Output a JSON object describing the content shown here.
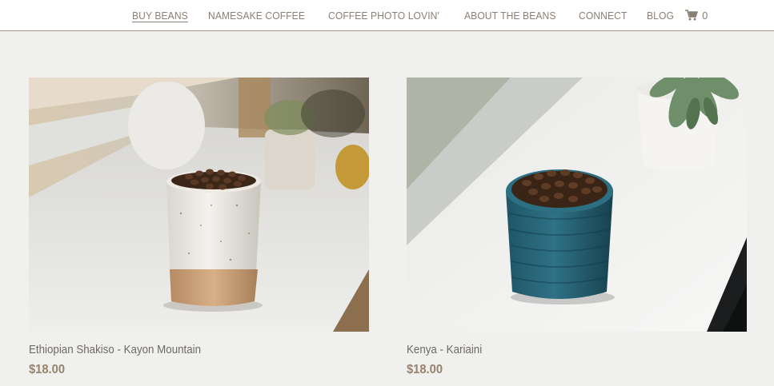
{
  "nav": {
    "items": [
      {
        "label": "BUY BEANS",
        "active": true
      },
      {
        "label": "NAMESAKE COFFEE",
        "active": false
      },
      {
        "label": "COFFEE PHOTO LOVIN'",
        "active": false
      },
      {
        "label": "ABOUT THE BEANS",
        "active": false
      },
      {
        "label": "CONNECT",
        "active": false
      },
      {
        "label": "BLOG",
        "active": false
      }
    ],
    "cart_icon": "shopping-cart-icon",
    "cart_count": "0"
  },
  "products": [
    {
      "name": "Ethiopian Shakiso - Kayon Mountain",
      "price": "$18.00",
      "image": "speckled-cream-cup-of-coffee-beans-photo"
    },
    {
      "name": "Kenya - Kariaini",
      "price": "$18.00",
      "image": "teal-ribbed-cup-of-coffee-beans-photo"
    }
  ],
  "colors": {
    "background": "#f0f0ee",
    "nav_text": "#8a7f74",
    "nav_border": "#a89b86",
    "product_name": "#6f6a66",
    "price": "#96826d"
  }
}
